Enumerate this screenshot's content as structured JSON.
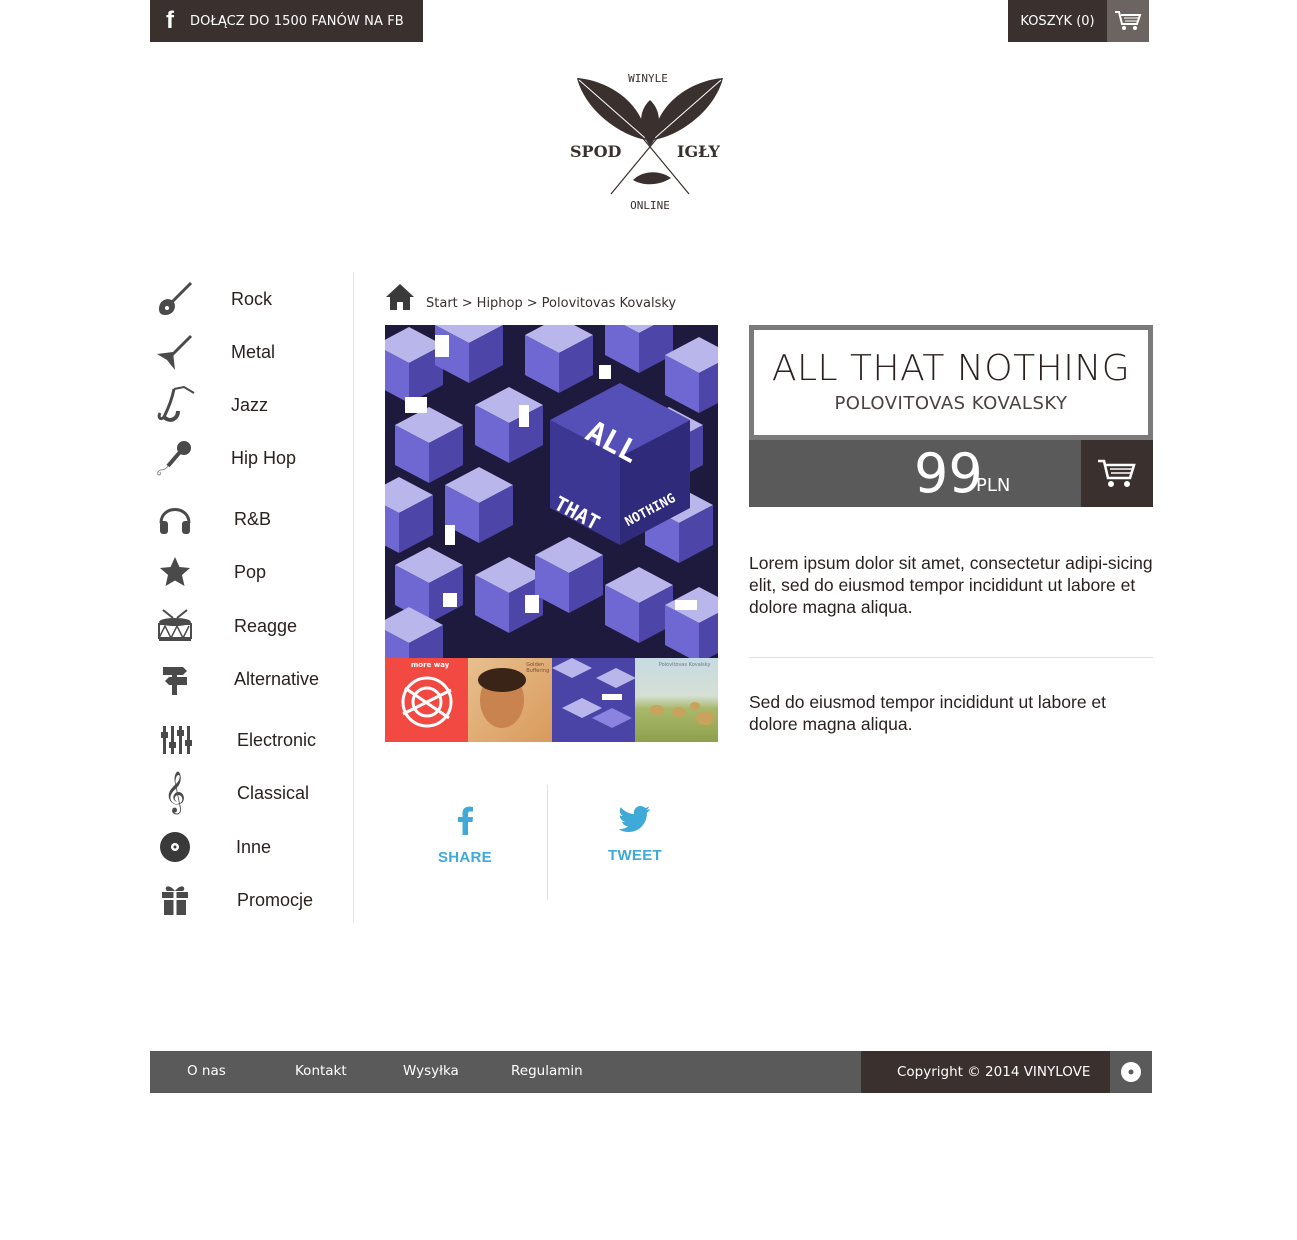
{
  "header": {
    "facebook_label": "DOŁĄCZ DO 1500 FANÓW NA FB",
    "facebook_glyph": "f",
    "cart_label": "KOSZYK (0)"
  },
  "logo": {
    "top": "WINYLE",
    "left": "SPOD",
    "right": "IGŁY",
    "bottom": "ONLINE"
  },
  "sidebar": {
    "items": [
      {
        "label": "Rock",
        "icon": "electric-guitar-icon"
      },
      {
        "label": "Metal",
        "icon": "flying-v-guitar-icon"
      },
      {
        "label": "Jazz",
        "icon": "saxophone-icon"
      },
      {
        "label": "Hip Hop",
        "icon": "microphone-icon"
      },
      {
        "label": "R&B",
        "icon": "headphones-icon"
      },
      {
        "label": "Pop",
        "icon": "star-icon"
      },
      {
        "label": "Reagge",
        "icon": "drum-icon"
      },
      {
        "label": "Alternative",
        "icon": "signpost-icon"
      },
      {
        "label": "Electronic",
        "icon": "mixer-sliders-icon"
      },
      {
        "label": "Classical",
        "icon": "treble-clef-icon"
      },
      {
        "label": "Inne",
        "icon": "vinyl-disc-icon"
      },
      {
        "label": "Promocje",
        "icon": "gift-icon"
      }
    ]
  },
  "breadcrumb": {
    "items": [
      "Start",
      "Hiphop",
      "Polovitovas Kovalsky"
    ],
    "separator": ">"
  },
  "product": {
    "title": "ALL THAT NOTHING",
    "artist": "POLOVITOVAS KOVALSKY",
    "price": "99",
    "currency": "PLN",
    "cover_text": [
      "ALL",
      "THAT",
      "NOTHING"
    ],
    "description_1": "Lorem ipsum dolor sit amet, consectetur adipi-sicing elit, sed do eiusmod tempor incididunt ut labore et dolore magna aliqua.",
    "description_2": "Sed do eiusmod tempor incididunt ut labore et dolore magna aliqua.",
    "thumb_1_text": "more way",
    "thumb_2_text": "Golden Buffering",
    "thumb_4_text": "Polovitovas Kovalsky"
  },
  "share": {
    "facebook_label": "SHARE",
    "twitter_label": "TWEET"
  },
  "footer": {
    "links": [
      "O nas",
      "Kontakt",
      "Wysyłka",
      "Regulamin"
    ],
    "copyright": "Copyright © 2014 VINYLOVE"
  },
  "colors": {
    "dark_brown": "#3a302d",
    "gray": "#5a5a5a",
    "share_blue": "#3fa9d8",
    "cover_purple": "#5b54b5"
  }
}
